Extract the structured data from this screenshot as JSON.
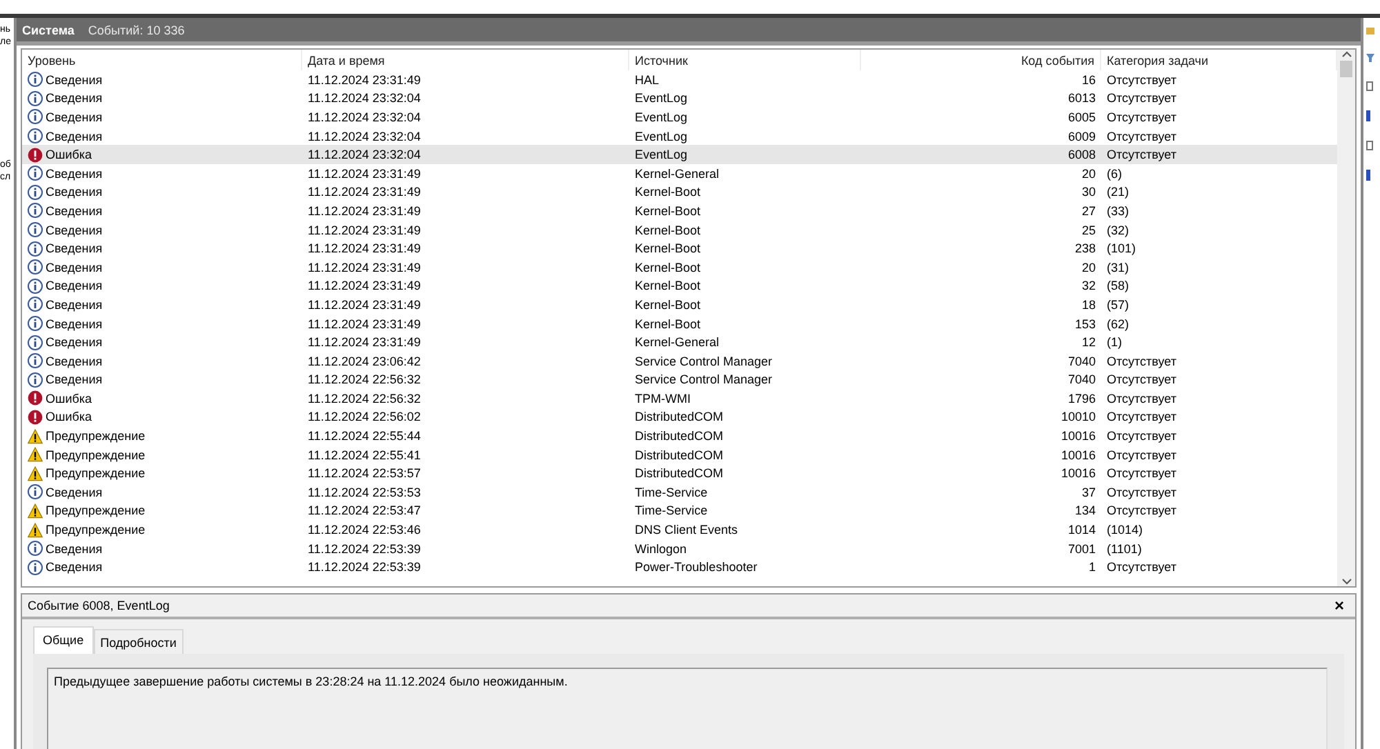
{
  "left_pane": {
    "fragments": [
      "нь",
      "ле",
      "об",
      "сл"
    ]
  },
  "log": {
    "title": "Система",
    "count": "Событий: 10 336"
  },
  "table": {
    "columns": [
      "Уровень",
      "Дата и время",
      "Источник",
      "Код события",
      "Категория задачи"
    ],
    "rows": [
      {
        "kind": "info",
        "level": "Сведения",
        "date": "11.12.2024 23:31:49",
        "source": "HAL",
        "code": "16",
        "category": "Отсутствует",
        "selected": false
      },
      {
        "kind": "info",
        "level": "Сведения",
        "date": "11.12.2024 23:32:04",
        "source": "EventLog",
        "code": "6013",
        "category": "Отсутствует",
        "selected": false
      },
      {
        "kind": "info",
        "level": "Сведения",
        "date": "11.12.2024 23:32:04",
        "source": "EventLog",
        "code": "6005",
        "category": "Отсутствует",
        "selected": false
      },
      {
        "kind": "info",
        "level": "Сведения",
        "date": "11.12.2024 23:32:04",
        "source": "EventLog",
        "code": "6009",
        "category": "Отсутствует",
        "selected": false
      },
      {
        "kind": "error",
        "level": "Ошибка",
        "date": "11.12.2024 23:32:04",
        "source": "EventLog",
        "code": "6008",
        "category": "Отсутствует",
        "selected": true
      },
      {
        "kind": "info",
        "level": "Сведения",
        "date": "11.12.2024 23:31:49",
        "source": "Kernel-General",
        "code": "20",
        "category": "(6)",
        "selected": false
      },
      {
        "kind": "info",
        "level": "Сведения",
        "date": "11.12.2024 23:31:49",
        "source": "Kernel-Boot",
        "code": "30",
        "category": "(21)",
        "selected": false
      },
      {
        "kind": "info",
        "level": "Сведения",
        "date": "11.12.2024 23:31:49",
        "source": "Kernel-Boot",
        "code": "27",
        "category": "(33)",
        "selected": false
      },
      {
        "kind": "info",
        "level": "Сведения",
        "date": "11.12.2024 23:31:49",
        "source": "Kernel-Boot",
        "code": "25",
        "category": "(32)",
        "selected": false
      },
      {
        "kind": "info",
        "level": "Сведения",
        "date": "11.12.2024 23:31:49",
        "source": "Kernel-Boot",
        "code": "238",
        "category": "(101)",
        "selected": false
      },
      {
        "kind": "info",
        "level": "Сведения",
        "date": "11.12.2024 23:31:49",
        "source": "Kernel-Boot",
        "code": "20",
        "category": "(31)",
        "selected": false
      },
      {
        "kind": "info",
        "level": "Сведения",
        "date": "11.12.2024 23:31:49",
        "source": "Kernel-Boot",
        "code": "32",
        "category": "(58)",
        "selected": false
      },
      {
        "kind": "info",
        "level": "Сведения",
        "date": "11.12.2024 23:31:49",
        "source": "Kernel-Boot",
        "code": "18",
        "category": "(57)",
        "selected": false
      },
      {
        "kind": "info",
        "level": "Сведения",
        "date": "11.12.2024 23:31:49",
        "source": "Kernel-Boot",
        "code": "153",
        "category": "(62)",
        "selected": false
      },
      {
        "kind": "info",
        "level": "Сведения",
        "date": "11.12.2024 23:31:49",
        "source": "Kernel-General",
        "code": "12",
        "category": "(1)",
        "selected": false
      },
      {
        "kind": "info",
        "level": "Сведения",
        "date": "11.12.2024 23:06:42",
        "source": "Service Control Manager",
        "code": "7040",
        "category": "Отсутствует",
        "selected": false
      },
      {
        "kind": "info",
        "level": "Сведения",
        "date": "11.12.2024 22:56:32",
        "source": "Service Control Manager",
        "code": "7040",
        "category": "Отсутствует",
        "selected": false
      },
      {
        "kind": "error",
        "level": "Ошибка",
        "date": "11.12.2024 22:56:32",
        "source": "TPM-WMI",
        "code": "1796",
        "category": "Отсутствует",
        "selected": false
      },
      {
        "kind": "error",
        "level": "Ошибка",
        "date": "11.12.2024 22:56:02",
        "source": "DistributedCOM",
        "code": "10010",
        "category": "Отсутствует",
        "selected": false
      },
      {
        "kind": "warning",
        "level": "Предупреждение",
        "date": "11.12.2024 22:55:44",
        "source": "DistributedCOM",
        "code": "10016",
        "category": "Отсутствует",
        "selected": false
      },
      {
        "kind": "warning",
        "level": "Предупреждение",
        "date": "11.12.2024 22:55:41",
        "source": "DistributedCOM",
        "code": "10016",
        "category": "Отсутствует",
        "selected": false
      },
      {
        "kind": "warning",
        "level": "Предупреждение",
        "date": "11.12.2024 22:53:57",
        "source": "DistributedCOM",
        "code": "10016",
        "category": "Отсутствует",
        "selected": false
      },
      {
        "kind": "info",
        "level": "Сведения",
        "date": "11.12.2024 22:53:53",
        "source": "Time-Service",
        "code": "37",
        "category": "Отсутствует",
        "selected": false
      },
      {
        "kind": "warning",
        "level": "Предупреждение",
        "date": "11.12.2024 22:53:47",
        "source": "Time-Service",
        "code": "134",
        "category": "Отсутствует",
        "selected": false
      },
      {
        "kind": "warning",
        "level": "Предупреждение",
        "date": "11.12.2024 22:53:46",
        "source": "DNS Client Events",
        "code": "1014",
        "category": "(1014)",
        "selected": false
      },
      {
        "kind": "info",
        "level": "Сведения",
        "date": "11.12.2024 22:53:39",
        "source": "Winlogon",
        "code": "7001",
        "category": "(1101)",
        "selected": false
      },
      {
        "kind": "info",
        "level": "Сведения",
        "date": "11.12.2024 22:53:39",
        "source": "Power-Troubleshooter",
        "code": "1",
        "category": "Отсутствует",
        "selected": false
      }
    ]
  },
  "details": {
    "title": "Событие 6008, EventLog",
    "close": "×",
    "tabs": [
      {
        "label": "Общие",
        "selected": true
      },
      {
        "label": "Подробности",
        "selected": false
      }
    ],
    "message": "Предыдущее завершение работы системы в 23:28:24 на 11.12.2024 было неожиданным."
  }
}
